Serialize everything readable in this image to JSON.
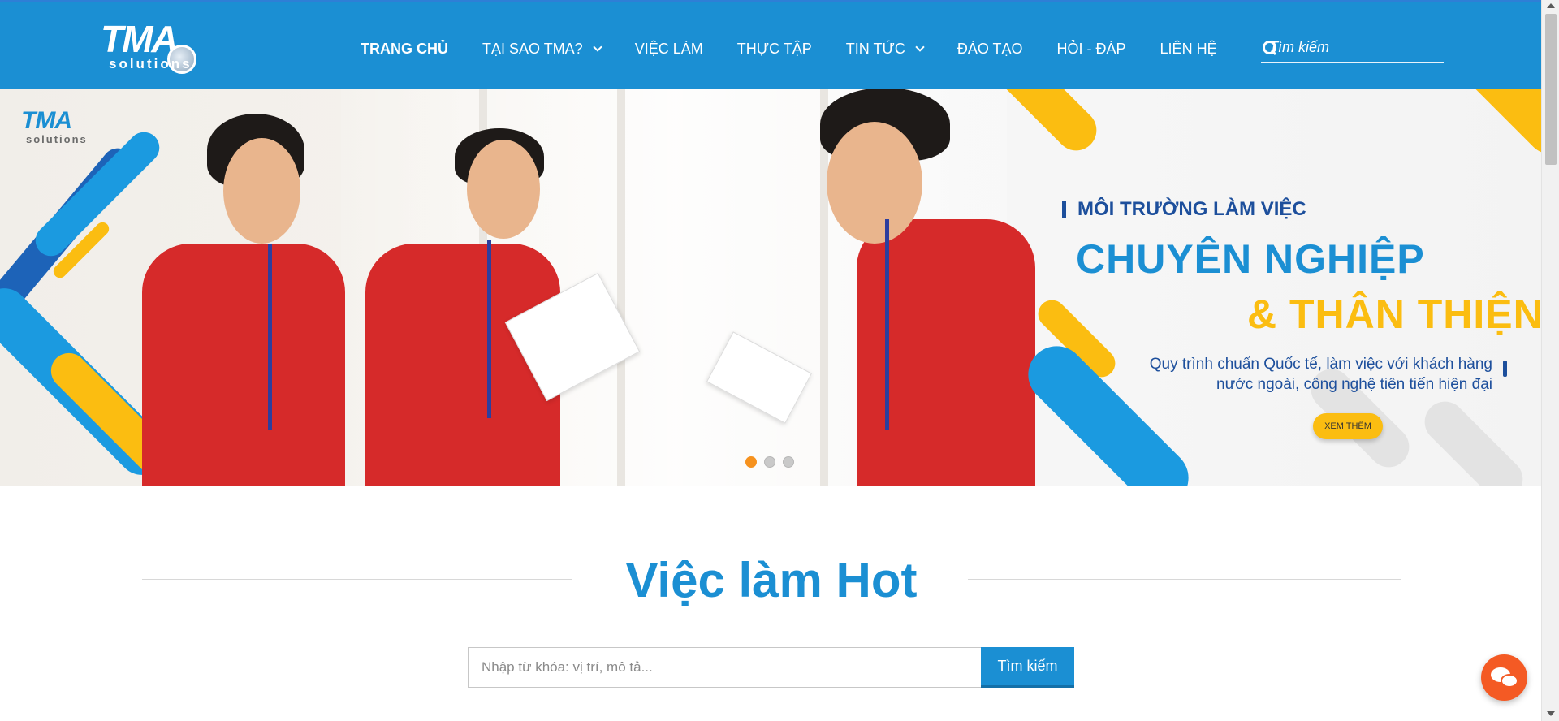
{
  "header": {
    "logo": {
      "main": "TMA",
      "sub": "solutions"
    },
    "nav": [
      {
        "label": "TRANG CHỦ",
        "active": true,
        "dropdown": false
      },
      {
        "label": "TẠI SAO TMA?",
        "active": false,
        "dropdown": true
      },
      {
        "label": "VIỆC LÀM",
        "active": false,
        "dropdown": false
      },
      {
        "label": "THỰC TẬP",
        "active": false,
        "dropdown": false
      },
      {
        "label": "TIN TỨC",
        "active": false,
        "dropdown": true
      },
      {
        "label": "ĐÀO TẠO",
        "active": false,
        "dropdown": false
      },
      {
        "label": "HỎI - ĐÁP",
        "active": false,
        "dropdown": false
      },
      {
        "label": "LIÊN HỆ",
        "active": false,
        "dropdown": false
      }
    ],
    "search": {
      "placeholder": "Tìm kiếm",
      "value": ""
    }
  },
  "banner": {
    "logo": {
      "main": "TMA",
      "sub": "solutions"
    },
    "subtitle": "MÔI TRƯỜNG LÀM VIỆC",
    "headline_1": "CHUYÊN NGHIỆP",
    "headline_2": "& THÂN THIỆN",
    "description": "Quy trình chuẩn Quốc tế, làm việc với khách hàng nước ngoài, công nghệ tiên tiến hiện đại",
    "cta_label": "XEM THÊM",
    "slides_total": 3,
    "active_slide": 1
  },
  "hot_jobs": {
    "title": "Việc làm Hot",
    "search_placeholder": "Nhập từ khóa: vị trí, mô tả...",
    "search_value": "",
    "search_button": "Tìm kiếm"
  },
  "colors": {
    "primary": "#1b8fd3",
    "accent_yellow": "#fbbd11",
    "navy": "#1d4f9c",
    "dot_active": "#f6921e",
    "chat": "#f45a24"
  },
  "icons": [
    "search-icon",
    "chevron-down-icon",
    "chat-icon",
    "globe-icon"
  ]
}
